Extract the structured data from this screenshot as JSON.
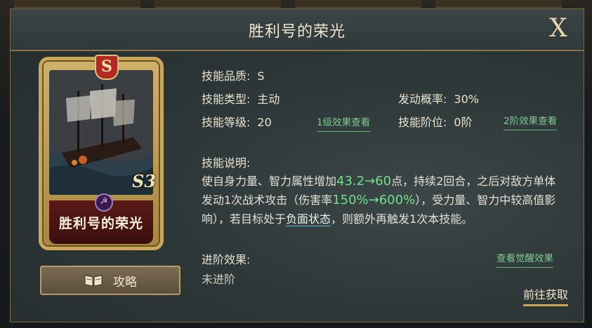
{
  "window": {
    "title": "胜利号的荣光",
    "close_label": "X"
  },
  "card": {
    "rank": "S",
    "level_mark": "S3",
    "name": "胜利号的荣光",
    "school_icon": "hammer-sickle-icon"
  },
  "guide_button": {
    "label": "攻略",
    "icon": "book-icon"
  },
  "details": {
    "quality_label": "技能品质:",
    "quality_value": "S",
    "type_label": "技能类型:",
    "type_value": "主动",
    "prob_label": "发动概率:",
    "prob_value": "30%",
    "level_label": "技能等级:",
    "level_value": "20",
    "level_link": "1级效果查看",
    "tier_label": "技能阶位:",
    "tier_value": "0阶",
    "tier_link": "2阶效果查看",
    "desc_label": "技能说明:",
    "desc_part1": "使自身力量、智力属性增加",
    "desc_hl1": "43.2→60",
    "desc_part2": "点，持续2回合，之后对敌方单体发动1次战术攻击（伤害率",
    "desc_hl2": "150%→600%",
    "desc_part3": "），受力量、智力中较高值影响），若目标处于",
    "desc_neg": "负面状态",
    "desc_part4": "，则额外再触发1次本技能。",
    "adv_label": "进阶效果:",
    "adv_link": "查看觉醒效果",
    "adv_value": "未进阶",
    "obtain_label": "前往获取"
  },
  "colors": {
    "highlight": "#6fe08c",
    "link": "#7dc98e",
    "gold": "#c7a756",
    "panel": "#2e3738"
  }
}
